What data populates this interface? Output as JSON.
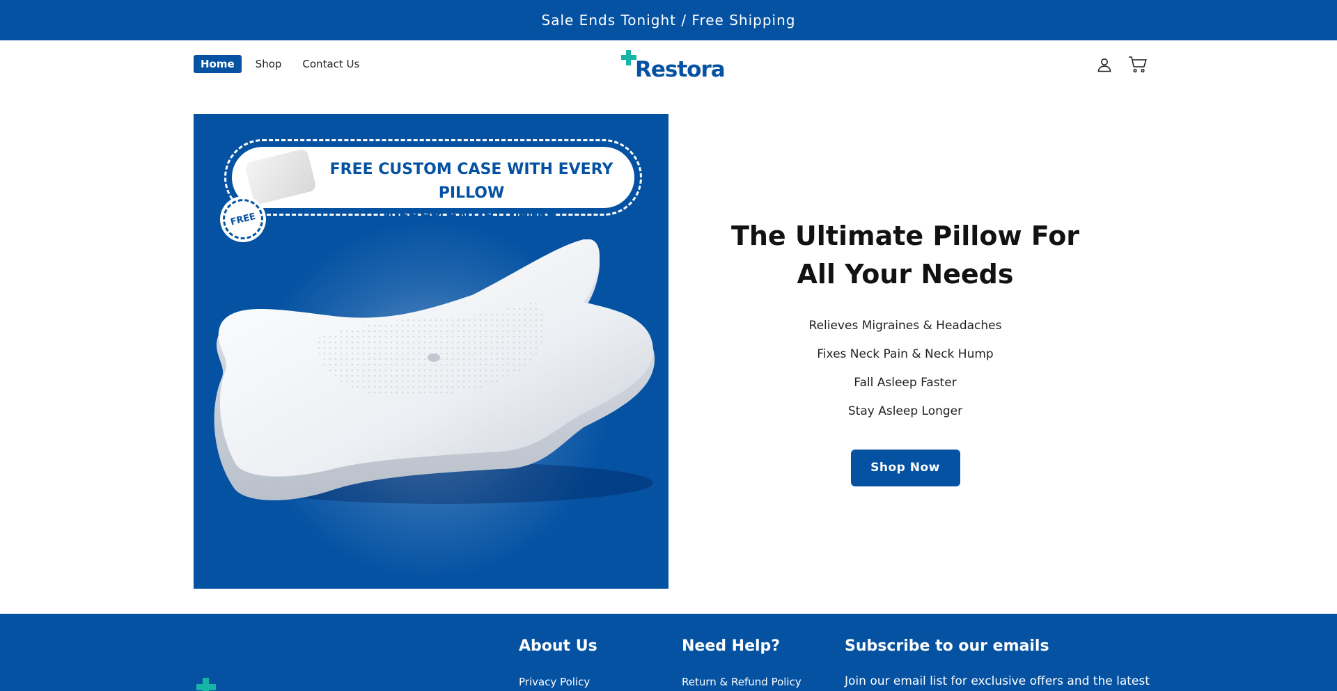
{
  "announcement": "Sale Ends Tonight / Free Shipping",
  "nav": {
    "home": "Home",
    "shop": "Shop",
    "contact": "Contact Us"
  },
  "logo": {
    "text": "Restora"
  },
  "header_icons": {
    "account": "account-icon",
    "cart": "cart-icon"
  },
  "hero": {
    "promo_line1": "FREE CUSTOM CASE WITH EVERY PILLOW",
    "promo_line2": "OFFER ENDS TODAY",
    "badge": "FREE",
    "headline": "The Ultimate Pillow For All Your Needs",
    "benefits": [
      "Relieves Migraines & Headaches",
      "Fixes Neck Pain & Neck Hump",
      "Fall Asleep Faster",
      "Stay Asleep Longer"
    ],
    "cta": "Shop Now"
  },
  "footer": {
    "about_title": "About Us",
    "about_link": "Privacy Policy",
    "help_title": "Need Help?",
    "help_link": "Return & Refund Policy",
    "subscribe_title": "Subscribe to our emails",
    "subscribe_text": "Join our email list for exclusive offers and the latest"
  },
  "colors": {
    "brand_blue": "#0552a3",
    "accent_teal": "#16b6a6"
  }
}
